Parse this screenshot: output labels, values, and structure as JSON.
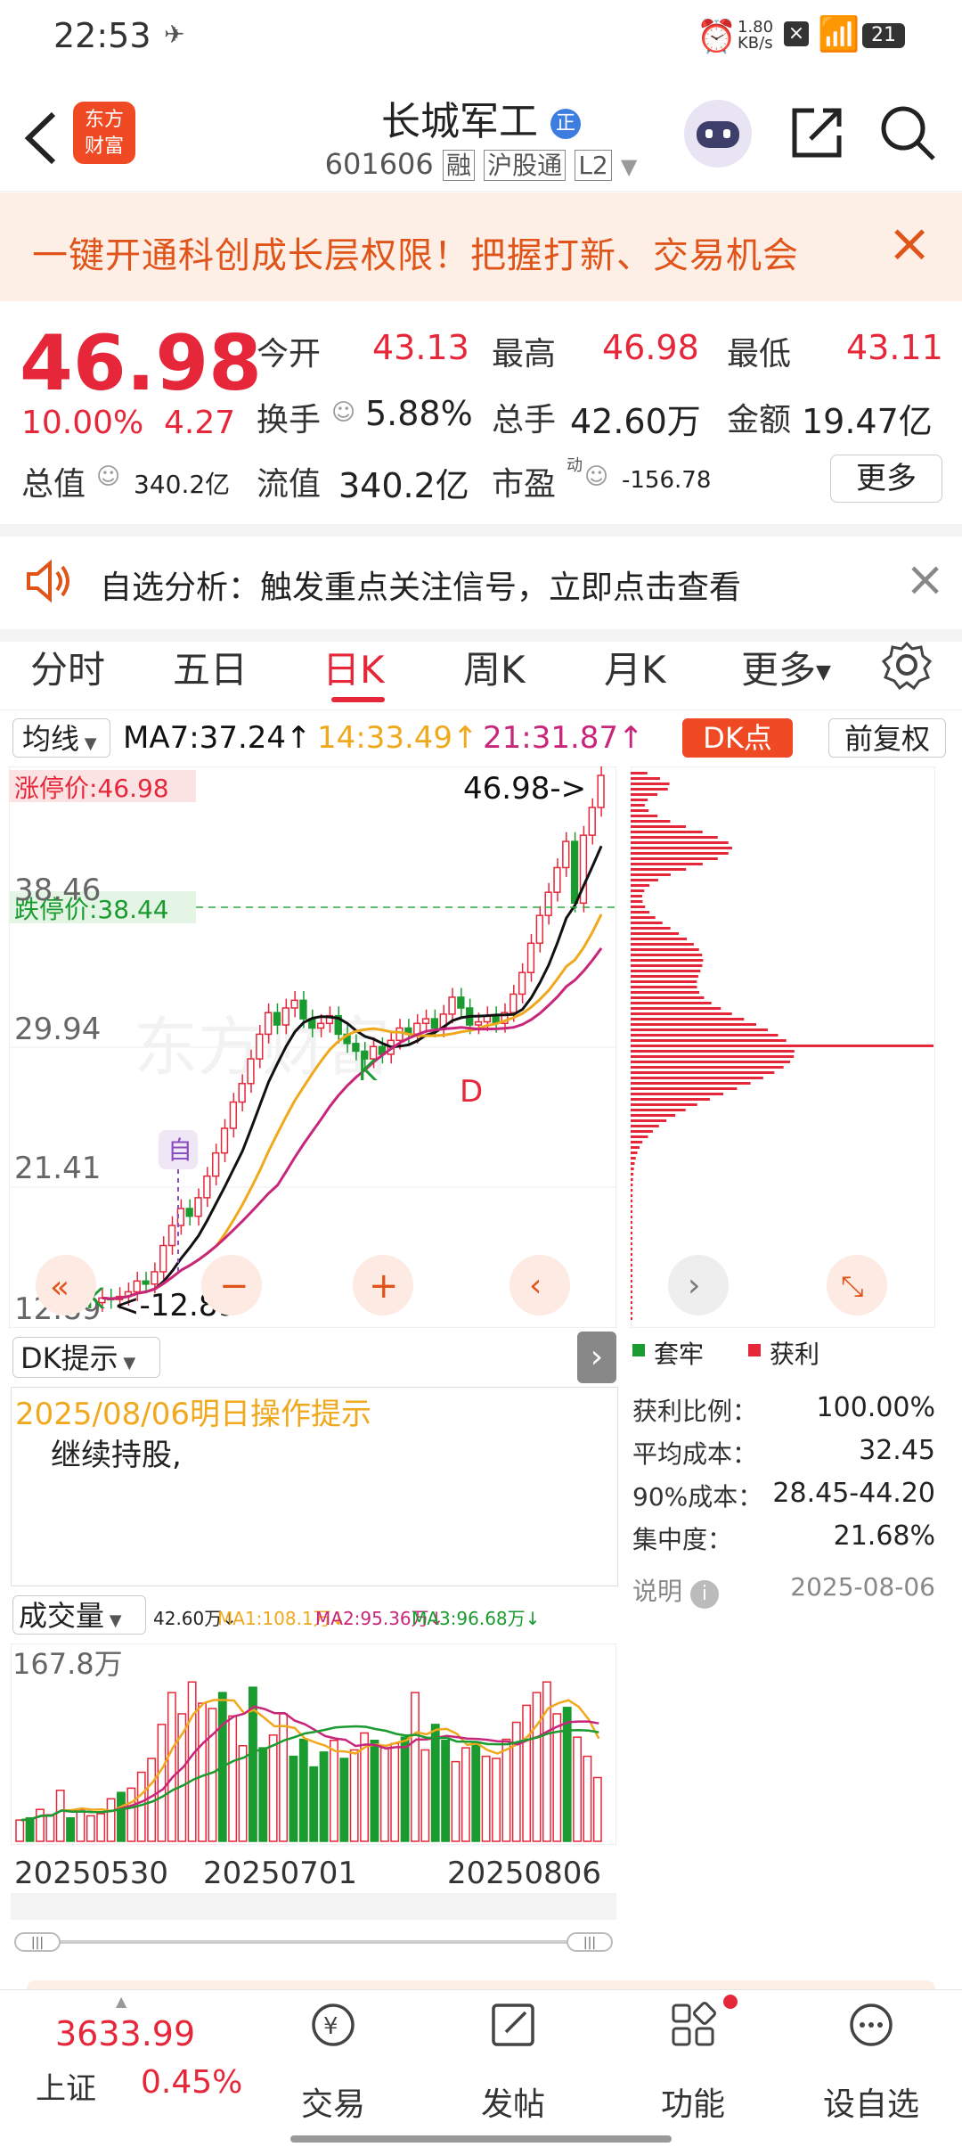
{
  "status_bar": {
    "time": "22:53",
    "net_speed_top": "1.80",
    "net_speed_unit": "KB/s",
    "battery": "21"
  },
  "header": {
    "back_icon": "chevron-left-icon",
    "logo_line1": "东方",
    "logo_line2": "财富",
    "stock_name": "长城军工",
    "badge": "正",
    "code": "601606",
    "tag_rong": "融",
    "tag_hgt": "沪股通",
    "tag_l2": "L2",
    "share_icon": "share-icon",
    "search_icon": "search-icon"
  },
  "banner": {
    "text": "一键开通科创成长层权限！把握打新、交易机会",
    "close": "×"
  },
  "quote": {
    "price": "46.98",
    "change_pct": "10.00%",
    "change_abs": "4.27",
    "open_label": "今开",
    "open": "43.13",
    "high_label": "最高",
    "high": "46.98",
    "low_label": "最低",
    "low": "43.11",
    "turnover_label": "换手",
    "turnover": "5.88%",
    "volume_label": "总手",
    "volume": "42.60万",
    "amount_label": "金额",
    "amount": "19.47亿",
    "mcap_label": "总值",
    "mcap": "340.2亿",
    "float_label": "流值",
    "float": "340.2亿",
    "pe_label": "市盈",
    "pe_sup": "动",
    "pe": "-156.78",
    "more_button": "更多"
  },
  "analysis": {
    "text": "自选分析：触发重点关注信号，立即点击查看",
    "close": "×"
  },
  "tabs": [
    "分时",
    "五日",
    "日K",
    "周K",
    "月K",
    "更多"
  ],
  "active_tab": 2,
  "ma_bar": {
    "selector": "均线",
    "ma7": "MA7:37.24",
    "ma14": "14:33.49",
    "ma21": "21:31.87",
    "dk_button": "DK点",
    "fuquan": "前复权"
  },
  "kchart": {
    "limit_up_label": "涨停价:46.98",
    "limit_down_label": "跌停价:38.44",
    "price_right": "46.98->",
    "axis_labels": [
      "38.46",
      "29.94",
      "21.41",
      "12.89"
    ],
    "low_marker": "<-12.89",
    "zi_marker": "自",
    "k_marker": "K",
    "d_marker": "D",
    "watermark": "东方财富"
  },
  "chip": {
    "legend_trap": "套牢",
    "legend_profit": "获利",
    "profit_ratio_label": "获利比例：",
    "profit_ratio": "100.00%",
    "avg_cost_label": "平均成本：",
    "avg_cost": "32.45",
    "cost90_label": "90%成本：",
    "cost90": "28.45-44.20",
    "concentration_label": "集中度：",
    "concentration": "21.68%",
    "explain_label": "说明",
    "date": "2025-08-06"
  },
  "dk": {
    "selector": "DK提示",
    "title": "2025/08/06明日操作提示",
    "content": "继续持股,"
  },
  "volume": {
    "selector": "成交量",
    "current": "42.60万↓",
    "ma1": "MA1:108.1万↓",
    "ma2": "MA2:95.36万↓",
    "ma3": "MA3:96.68万↓",
    "max_label": "167.8万",
    "dates": [
      "20250530",
      "20250701",
      "20250806"
    ]
  },
  "bottom_nav": {
    "index_value": "3633.99",
    "index_name": "上证",
    "index_change": "0.45%",
    "items": [
      "交易",
      "发帖",
      "功能",
      "设自选"
    ]
  },
  "colors": {
    "up": "#e6273a",
    "down": "#1a9b2f",
    "ma7": "#111111",
    "ma14": "#f0a81c",
    "ma21": "#c8267a",
    "banner_bg": "#fdeee6",
    "banner_text": "#e0541a"
  }
}
